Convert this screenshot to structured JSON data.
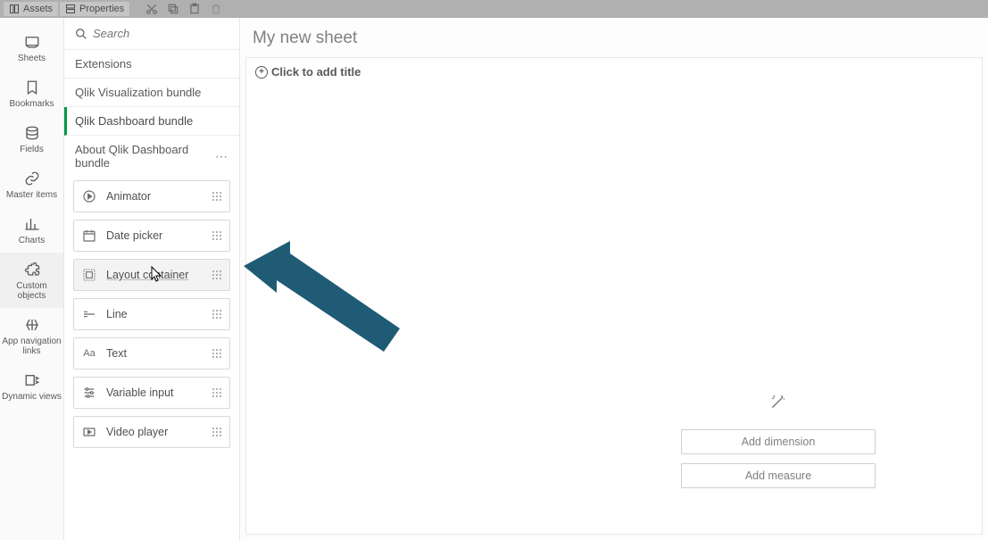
{
  "toolbar": {
    "assets": "Assets",
    "properties": "Properties"
  },
  "rail": {
    "items": [
      {
        "label": "Sheets",
        "icon": "sheets"
      },
      {
        "label": "Bookmarks",
        "icon": "bookmark"
      },
      {
        "label": "Fields",
        "icon": "db"
      },
      {
        "label": "Master items",
        "icon": "link"
      },
      {
        "label": "Charts",
        "icon": "chart"
      },
      {
        "label": "Custom objects",
        "icon": "puzzle"
      },
      {
        "label": "App navigation links",
        "icon": "navlink"
      },
      {
        "label": "Dynamic views",
        "icon": "dynviews"
      }
    ],
    "active_index": 5
  },
  "asset_panel": {
    "search_placeholder": "Search",
    "headers": {
      "a": "Extensions",
      "b": "Qlik Visualization bundle",
      "c": "Qlik Dashboard bundle",
      "about": "About Qlik Dashboard bundle"
    },
    "items": [
      {
        "label": "Animator",
        "icon": "play"
      },
      {
        "label": "Date picker",
        "icon": "calendar"
      },
      {
        "label": "Layout container",
        "icon": "layout"
      },
      {
        "label": "Line",
        "icon": "line"
      },
      {
        "label": "Text",
        "icon": "text"
      },
      {
        "label": "Variable input",
        "icon": "sliders"
      },
      {
        "label": "Video player",
        "icon": "video"
      }
    ],
    "hovered_index": 2
  },
  "canvas": {
    "sheet_title": "My new sheet",
    "add_title_label": "Click to add title",
    "add_dimension": "Add dimension",
    "add_measure": "Add measure"
  },
  "colors": {
    "arrow": "#1f5b74"
  }
}
